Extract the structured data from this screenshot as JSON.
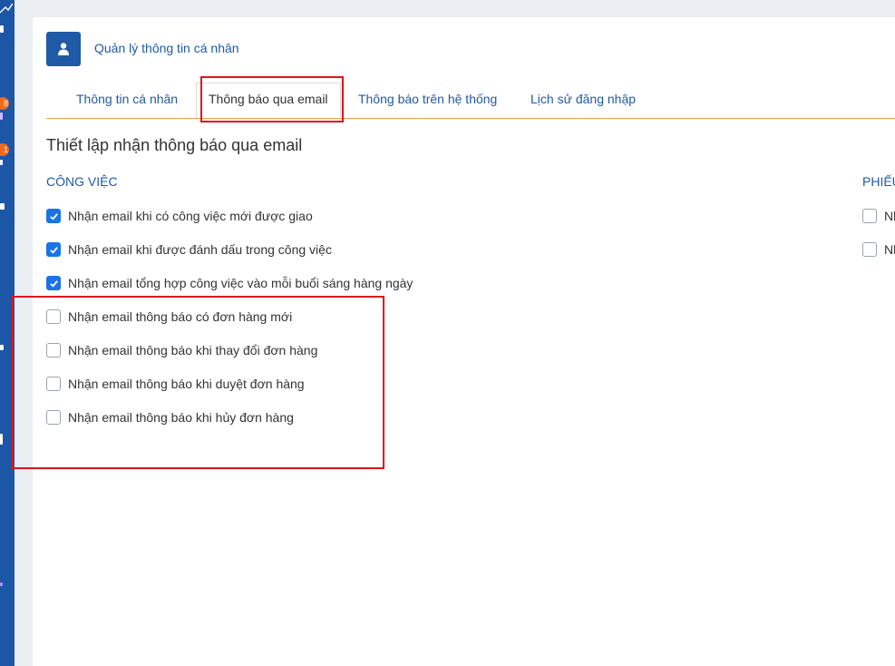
{
  "sidebar": {
    "badges": [
      "8",
      "1"
    ]
  },
  "header": {
    "icon": "user-icon",
    "title": "Quản lý thông tin cá nhân"
  },
  "tabs": [
    {
      "label": "Thông tin cá nhân",
      "active": false
    },
    {
      "label": "Thông báo qua email",
      "active": true
    },
    {
      "label": "Thông báo trên hệ thống",
      "active": false
    },
    {
      "label": "Lịch sử đăng nhập",
      "active": false
    }
  ],
  "section": {
    "title": "Thiết lập nhận thông báo qua email"
  },
  "groups": {
    "work": {
      "label": "CÔNG VIỆC",
      "options": [
        {
          "label": "Nhận email khi có công việc mới được giao",
          "checked": true
        },
        {
          "label": "Nhận email khi được đánh dấu trong công việc",
          "checked": true
        },
        {
          "label": "Nhận email tổng hợp công việc vào mỗi buổi sáng hàng ngày",
          "checked": true
        },
        {
          "label": "Nhận email thông báo có đơn hàng mới",
          "checked": false
        },
        {
          "label": "Nhận email thông báo khi thay đổi đơn hàng",
          "checked": false
        },
        {
          "label": "Nhận email thông báo khi duyệt đơn hàng",
          "checked": false
        },
        {
          "label": "Nhận email thông báo khi hủy đơn hàng",
          "checked": false
        }
      ]
    },
    "right": {
      "label": "PHIẾU",
      "options": [
        {
          "label": "Nh",
          "checked": false
        },
        {
          "label": "Nh",
          "checked": false
        }
      ]
    }
  },
  "colors": {
    "accent": "#1f5aa6",
    "checkbox": "#1a73e8",
    "tab_border": "#f0a04b",
    "annotation": "#e0141c"
  }
}
